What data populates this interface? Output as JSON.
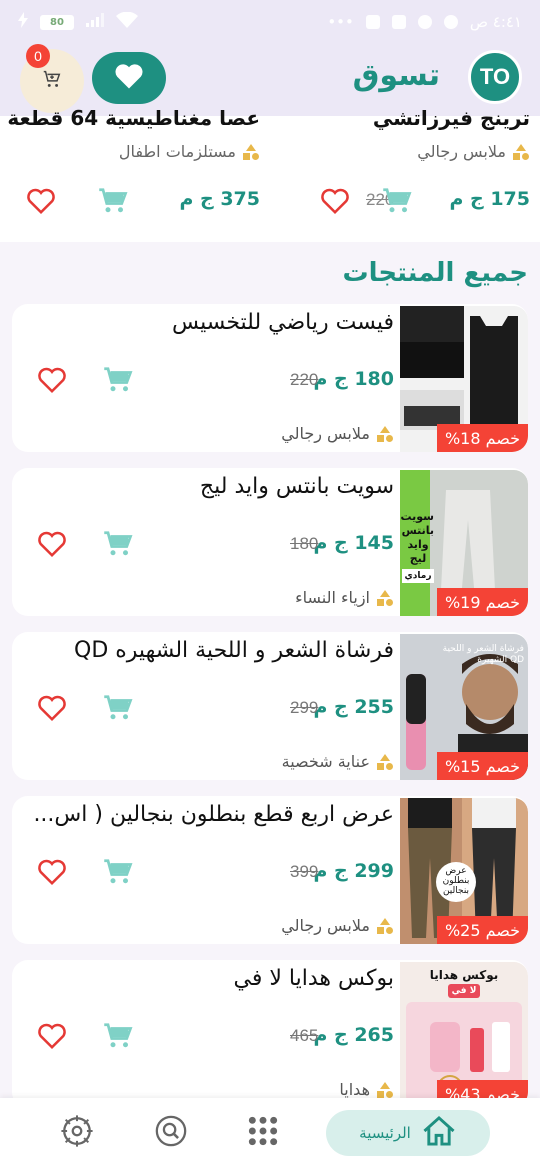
{
  "app": {
    "title": "تسوق",
    "logo_text": "TO"
  },
  "statusbar": {
    "battery": "80",
    "time": "٤:٤١ ص"
  },
  "header": {
    "cart_count": "0"
  },
  "top_strip": [
    {
      "title": "ترينج فيرزاتشي",
      "category": "ملابس رجالي",
      "price": "175 ج م",
      "old_price": "220"
    },
    {
      "title": "عصا مغناطيسية 64 قطعة",
      "category": "مستلزمات اطفال",
      "price": "375 ج م",
      "old_price": ""
    }
  ],
  "section": {
    "title": "جميع المنتجات"
  },
  "products": [
    {
      "title": "فيست رياضي للتخسيس",
      "price": "180 ج م",
      "old_price": "220",
      "category": "ملابس رجالي",
      "discount": "خصم 18%"
    },
    {
      "title": "سويت بانتس وايد ليج",
      "price": "145 ج م",
      "old_price": "180",
      "category": "ازياء النساء",
      "discount": "خصم 19%"
    },
    {
      "title": "فرشاة الشعر و اللحية الشهيره QD",
      "price": "255 ج م",
      "old_price": "299",
      "category": "عناية شخصية",
      "discount": "خصم 15%"
    },
    {
      "title": "عرض اربع قطع بنطلون بنجالين ( اس...",
      "price": "299 ج م",
      "old_price": "399",
      "category": "ملابس رجالي",
      "discount": "خصم 25%"
    },
    {
      "title": "بوكس هدايا لا في",
      "price": "265 ج م",
      "old_price": "465",
      "category": "هدايا",
      "discount": "خصم 43%"
    }
  ],
  "thumbs": {
    "p2": [
      "سويت",
      "بانتس",
      "وايد ليج",
      "رمادي"
    ],
    "p3": [
      "فرشاة الشعر و اللحية",
      "QD الشهيرة"
    ],
    "p4": [
      "عرض",
      "4",
      "بنطلون",
      "بنجالين"
    ],
    "p5": [
      "بوكس هدايا",
      "لا في"
    ]
  },
  "nav": {
    "home_label": "الرئيسية"
  },
  "colors": {
    "accent": "#1e9081",
    "sale": "#f44336",
    "heart": "#e53935"
  }
}
